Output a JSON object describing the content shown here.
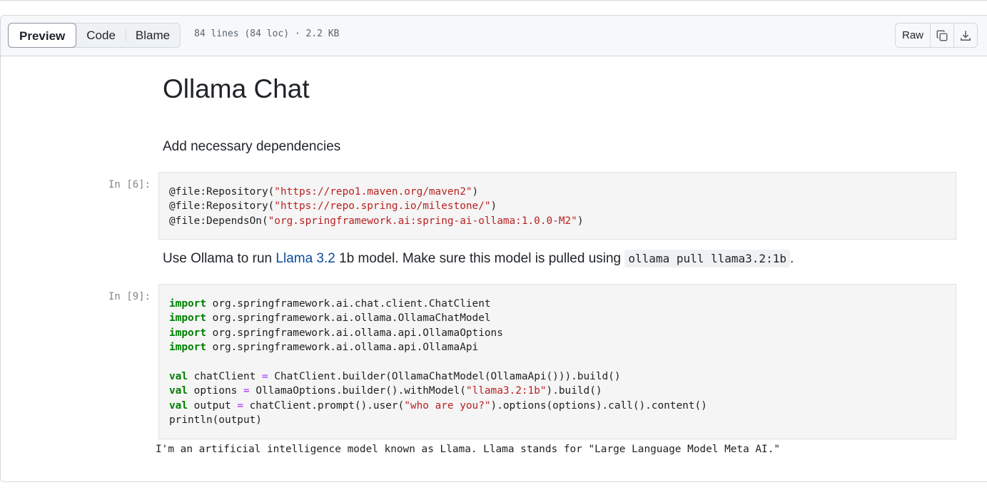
{
  "header": {
    "tabs": [
      {
        "label": "Preview",
        "active": true
      },
      {
        "label": "Code",
        "active": false
      },
      {
        "label": "Blame",
        "active": false
      }
    ],
    "meta": "84 lines (84 loc) · 2.2 KB",
    "raw_label": "Raw",
    "copy_icon": "copy-icon",
    "download_icon": "download-icon"
  },
  "notebook": {
    "title": "Ollama Chat",
    "intro": "Add necessary dependencies",
    "cell1": {
      "prompt": "In [6]:",
      "lines": [
        {
          "pre": "@file:Repository(",
          "str": "\"https://repo1.maven.org/maven2\"",
          "post": ")"
        },
        {
          "pre": "@file:Repository(",
          "str": "\"https://repo.spring.io/milestone/\"",
          "post": ")"
        },
        {
          "pre": "@file:DependsOn(",
          "str": "\"org.springframework.ai:spring-ai-ollama:1.0.0-M2\"",
          "post": ")"
        }
      ]
    },
    "text2": {
      "before": "Use Ollama to run ",
      "link": "Llama 3.2",
      "middle": " 1b model. Make sure this model is pulled using ",
      "code": "ollama pull llama3.2:1b",
      "after": "."
    },
    "cell2": {
      "prompt": "In [9]:",
      "imports": [
        "org.springframework.ai.chat.client.ChatClient",
        "org.springframework.ai.ollama.OllamaChatModel",
        "org.springframework.ai.ollama.api.OllamaOptions",
        "org.springframework.ai.ollama.api.OllamaApi"
      ],
      "import_kw": "import",
      "val_kw": "val",
      "eq": "=",
      "line1_name": " chatClient ",
      "line1_rest": " ChatClient.builder(OllamaChatModel(OllamaApi())).build()",
      "line2_name": " options ",
      "line2_a": " OllamaOptions.builder().withModel(",
      "line2_str": "\"llama3.2:1b\"",
      "line2_b": ").build()",
      "line3_name": " output ",
      "line3_a": " chatClient.prompt().user(",
      "line3_str": "\"who are you?\"",
      "line3_b": ").options(options).call().content()",
      "line4": "println(output)"
    },
    "output": "I'm an artificial intelligence model known as Llama. Llama stands for \"Large Language Model Meta AI.\""
  },
  "colors": {
    "keyword": "#008000",
    "string": "#ba2121",
    "operator": "#aa22ff",
    "link": "#0d4a9b"
  }
}
